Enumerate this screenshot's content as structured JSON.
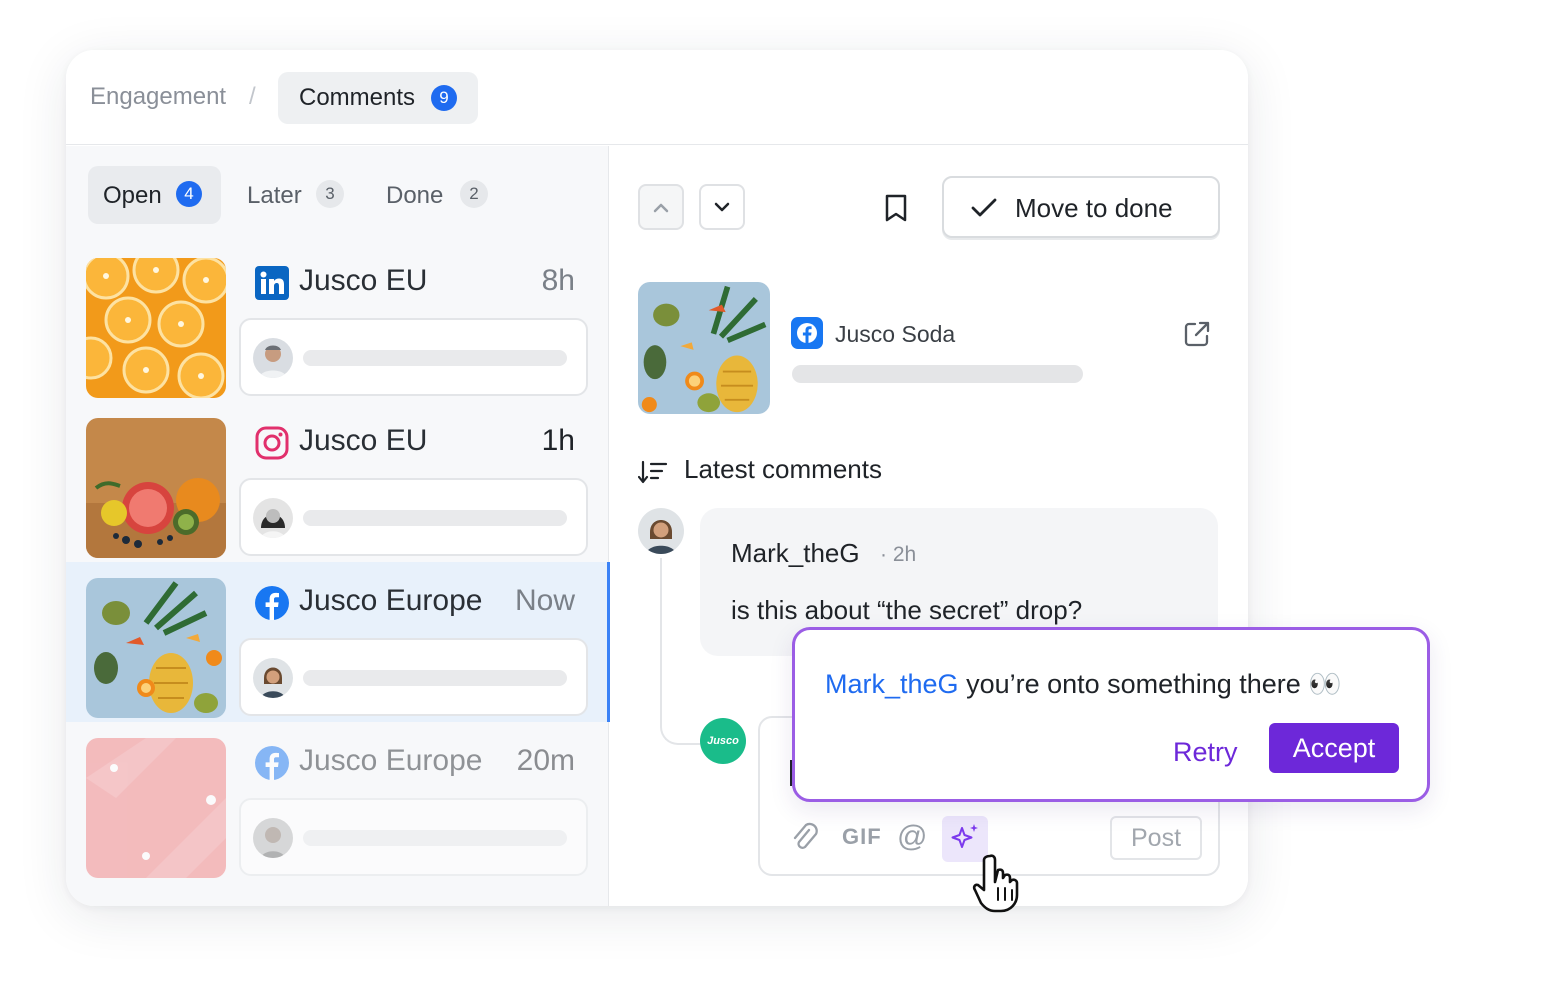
{
  "breadcrumb": {
    "section": "Engagement",
    "separator": "/",
    "current": "Comments",
    "current_count": "9"
  },
  "filters": [
    {
      "label": "Open",
      "count": "4"
    },
    {
      "label": "Later",
      "count": "3"
    },
    {
      "label": "Done",
      "count": "2"
    }
  ],
  "conversations": [
    {
      "network": "linkedin-icon",
      "account": "Jusco EU",
      "time": "8h"
    },
    {
      "network": "instagram-icon",
      "account": "Jusco EU",
      "time": "1h"
    },
    {
      "network": "facebook-icon",
      "account": "Jusco Europe",
      "time": "Now",
      "selected": true
    },
    {
      "network": "facebook-icon",
      "account": "Jusco Europe",
      "time": "20m"
    }
  ],
  "toolbar": {
    "move_to_done_label": "Move to done"
  },
  "post": {
    "network": "facebook-icon",
    "account": "Jusco Soda"
  },
  "comments_section": {
    "heading": "Latest comments"
  },
  "comment": {
    "author": "Mark_theG",
    "ago": "· 2h",
    "text": "is this about “the secret” drop?"
  },
  "composer": {
    "gif_label": "GIF",
    "mention_label": "@",
    "post_label": "Post",
    "avatar_text": "Jusco"
  },
  "suggestion": {
    "mention": "Mark_theG",
    "text": "you’re onto something there 👀",
    "retry_label": "Retry",
    "accept_label": "Accept"
  },
  "colors": {
    "accent_blue": "#1f6bf0",
    "ai_purple": "#6d28d9",
    "selected_bg": "#e8f1fb"
  }
}
